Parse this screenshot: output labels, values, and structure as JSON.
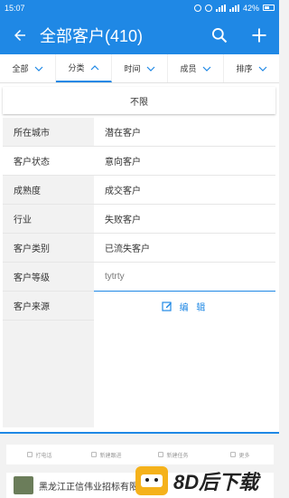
{
  "status_bar": {
    "time": "15:07",
    "battery": "42%"
  },
  "app_bar": {
    "title": "全部客户(410)"
  },
  "filter_tabs": [
    {
      "label": "全部",
      "active": false
    },
    {
      "label": "分类",
      "active": true
    },
    {
      "label": "时间",
      "active": false
    },
    {
      "label": "成员",
      "active": false
    },
    {
      "label": "排序",
      "active": false
    }
  ],
  "dropdown": {
    "unlimited_label": "不限",
    "categories": [
      "所在城市",
      "客户状态",
      "成熟度",
      "行业",
      "客户类别",
      "客户等级",
      "客户来源"
    ],
    "selected_category": "客户状态",
    "options": [
      "潜在客户",
      "意向客户",
      "成交客户",
      "失败客户",
      "已流失客户"
    ],
    "input_value": "tytrty",
    "edit_label": "编 辑"
  },
  "action_bar": {
    "items": [
      "打电话",
      "新建跟进",
      "新建任务",
      "更多"
    ]
  },
  "bottom_card": {
    "text": "黑龙江正信伟业招标有限公司"
  },
  "watermark": {
    "text": "8D后下载"
  },
  "colors": {
    "primary": "#1f88e5"
  }
}
